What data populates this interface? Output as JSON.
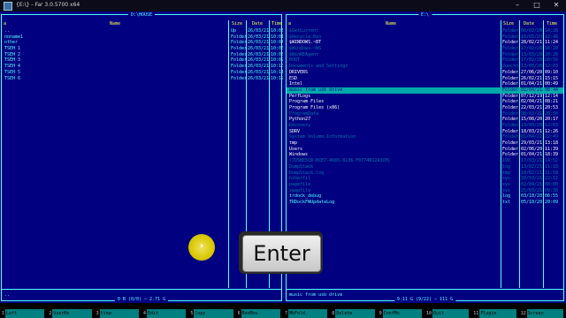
{
  "window": {
    "title": "{E:\\} - Far 3.0.5700 x64"
  },
  "left_panel": {
    "path": "D:\\HOUSE",
    "columns": {
      "name": "Name",
      "size": "Size",
      "date": "Date",
      "time": "Time"
    },
    "corner": "a",
    "rows": [
      {
        "name": "..",
        "size": "Up",
        "date": "26/03/21",
        "time": "10:03"
      },
      {
        "name": "noname1",
        "size": "Folder",
        "date": "26/03/21",
        "time": "10:01"
      },
      {
        "name": "other",
        "size": "Folder",
        "date": "26/03/21",
        "time": "10:04"
      },
      {
        "name": "TSEH 1",
        "size": "Folder",
        "date": "26/03/21",
        "time": "10:06"
      },
      {
        "name": "TSEH 2",
        "size": "Folder",
        "date": "26/03/21",
        "time": "10:08"
      },
      {
        "name": "TSEH 3",
        "size": "Folder",
        "date": "26/03/21",
        "time": "10:09"
      },
      {
        "name": "TSEH 4",
        "size": "Folder",
        "date": "26/03/21",
        "time": "10:10"
      },
      {
        "name": "TSEH 5",
        "size": "Folder",
        "date": "26/03/21",
        "time": "10:11"
      },
      {
        "name": "TSEH 6",
        "size": "Folder",
        "date": "26/03/21",
        "time": "10:12"
      }
    ],
    "status": "..",
    "free": "0 B (0/0) — 2.71 G"
  },
  "right_panel": {
    "path": "E:\\",
    "columns": {
      "name": "Name",
      "size": "Size",
      "date": "Date",
      "time": "Time"
    },
    "corner": "a",
    "rows": [
      {
        "name": "$GetCurrent",
        "size": "Folder",
        "date": "08/02/20",
        "time": "14:20",
        "style": "dim"
      },
      {
        "name": "$Recycle.Bin",
        "size": "Folder",
        "date": "16/03/20",
        "time": "12:48",
        "style": "dim"
      },
      {
        "name": "$WINDOWS.~BT",
        "size": "Folder",
        "date": "28/02/21",
        "time": "11:24",
        "style": "white"
      },
      {
        "name": "$Windows.~WS",
        "size": "Folder",
        "date": "17/02/20",
        "time": "16:20",
        "style": "dim"
      },
      {
        "name": "$WinREAgent",
        "size": "Folder",
        "date": "13/03/20",
        "time": "10:28",
        "style": "dim"
      },
      {
        "name": "BOOT",
        "size": "Folder",
        "date": "17/02/20",
        "time": "20:56",
        "style": "dim"
      },
      {
        "name": "Documents and Settings",
        "size": "Junctn",
        "date": "13/03/20",
        "time": "12:03",
        "style": "dim"
      },
      {
        "name": "DRIVERS",
        "size": "Folder",
        "date": "27/06/20",
        "time": "09:10",
        "style": "white"
      },
      {
        "name": "ESD",
        "size": "Folder",
        "date": "26/02/21",
        "time": "15:15",
        "style": "white"
      },
      {
        "name": "Intel",
        "size": "Folder",
        "date": "01/04/21",
        "time": "00:49",
        "style": "white"
      },
      {
        "name": "music from usb drive",
        "size": "Folder",
        "date": "02/04/21",
        "time": "08:44",
        "style": "sel"
      },
      {
        "name": "PerfLogs",
        "size": "Folder",
        "date": "07/12/19",
        "time": "12:14",
        "style": "white"
      },
      {
        "name": "Program Files",
        "size": "Folder",
        "date": "02/04/21",
        "time": "08:21",
        "style": "white"
      },
      {
        "name": "Program Files (x86)",
        "size": "Folder",
        "date": "22/03/21",
        "time": "20:53",
        "style": "white"
      },
      {
        "name": "ProgramData",
        "size": "Folder",
        "date": "30/03/21",
        "time": "20:56",
        "style": "dim"
      },
      {
        "name": "Python27",
        "size": "Folder",
        "date": "15/08/20",
        "time": "20:17",
        "style": "white"
      },
      {
        "name": "Recovery",
        "size": "Folder",
        "date": "13/03/20",
        "time": "12:03",
        "style": "dim"
      },
      {
        "name": "SDRV",
        "size": "Folder",
        "date": "18/03/21",
        "time": "12:26",
        "style": "white"
      },
      {
        "name": "System Volume Information",
        "size": "Folder",
        "date": "01/04/21",
        "time": "22:49",
        "style": "dim"
      },
      {
        "name": "tmp",
        "size": "Folder",
        "date": "29/03/21",
        "time": "13:18",
        "style": "white"
      },
      {
        "name": "Users",
        "size": "Folder",
        "date": "02/06/20",
        "time": "11:39",
        "style": "white"
      },
      {
        "name": "Windows",
        "size": "Folder",
        "date": "01/04/21",
        "time": "18:39",
        "style": "white"
      },
      {
        "name": "{7D5BE5CB-BCE7-4685-8136-F0774B12A3CM}",
        "size": "198",
        "date": "17/03/21",
        "time": "14:52",
        "style": "dim"
      },
      {
        "name": "DumpStack",
        "size": "log",
        "date": "13/02/21",
        "time": "11:18",
        "style": "dim"
      },
      {
        "name": "DumpStack.log",
        "size": "tmp",
        "date": "18/02/21",
        "time": "11:58",
        "style": "dim"
      },
      {
        "name": "hiberfil",
        "size": "sys",
        "date": "30/03/21",
        "time": "22:12",
        "style": "dim"
      },
      {
        "name": "pagefile",
        "size": "sys",
        "date": "02/04/21",
        "time": "08:00",
        "style": "dim"
      },
      {
        "name": "swapfile",
        "size": "sys",
        "date": "25/03/21",
        "time": "09:38",
        "style": "dim"
      },
      {
        "name": "trdock_debug",
        "size": "log",
        "date": "03/10/20",
        "time": "06:55",
        "style": "plain"
      },
      {
        "name": "TRDockFWUpdateLog",
        "size": "txt",
        "date": "05/10/20",
        "time": "20:09",
        "style": "plain"
      }
    ],
    "status": "music from usb drive",
    "free": "9.11 G (9/22) — 111 G"
  },
  "keybar": [
    {
      "num": "1",
      "label": "Left"
    },
    {
      "num": "2",
      "label": "UserMn"
    },
    {
      "num": "3",
      "label": "View"
    },
    {
      "num": "4",
      "label": "Edit"
    },
    {
      "num": "5",
      "label": "Copy"
    },
    {
      "num": "6",
      "label": "RenMov"
    },
    {
      "num": "7",
      "label": "MkFold"
    },
    {
      "num": "8",
      "label": "Delete"
    },
    {
      "num": "9",
      "label": "ConfMn"
    },
    {
      "num": "10",
      "label": "Quit"
    },
    {
      "num": "11",
      "label": "Plugin"
    },
    {
      "num": "12",
      "label": "Screen"
    }
  ],
  "overlay": {
    "key_label": "Enter"
  }
}
